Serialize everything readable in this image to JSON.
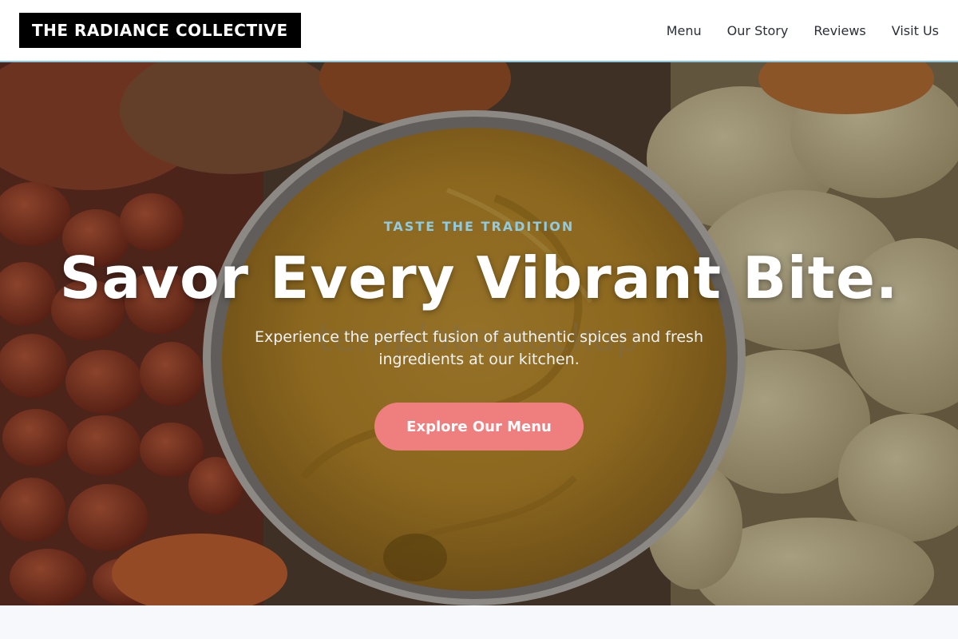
{
  "header": {
    "brand": "THE RADIANCE COLLECTIVE",
    "nav": [
      {
        "label": "Menu"
      },
      {
        "label": "Our Story"
      },
      {
        "label": "Reviews"
      },
      {
        "label": "Visit Us"
      }
    ]
  },
  "hero": {
    "eyebrow": "TASTE THE TRADITION",
    "headline": "Savor Every Vibrant Bite.",
    "subtext": "Experience the perfect fusion of authentic spices and fresh ingredients at our kitchen.",
    "cta_label": "Explore Our Menu",
    "watermark": "templatemockup"
  },
  "colors": {
    "accent": "#ef7f7f",
    "eyebrow": "#8fcbe2",
    "header_border": "#8cc7de",
    "brand_bg": "#000000"
  }
}
